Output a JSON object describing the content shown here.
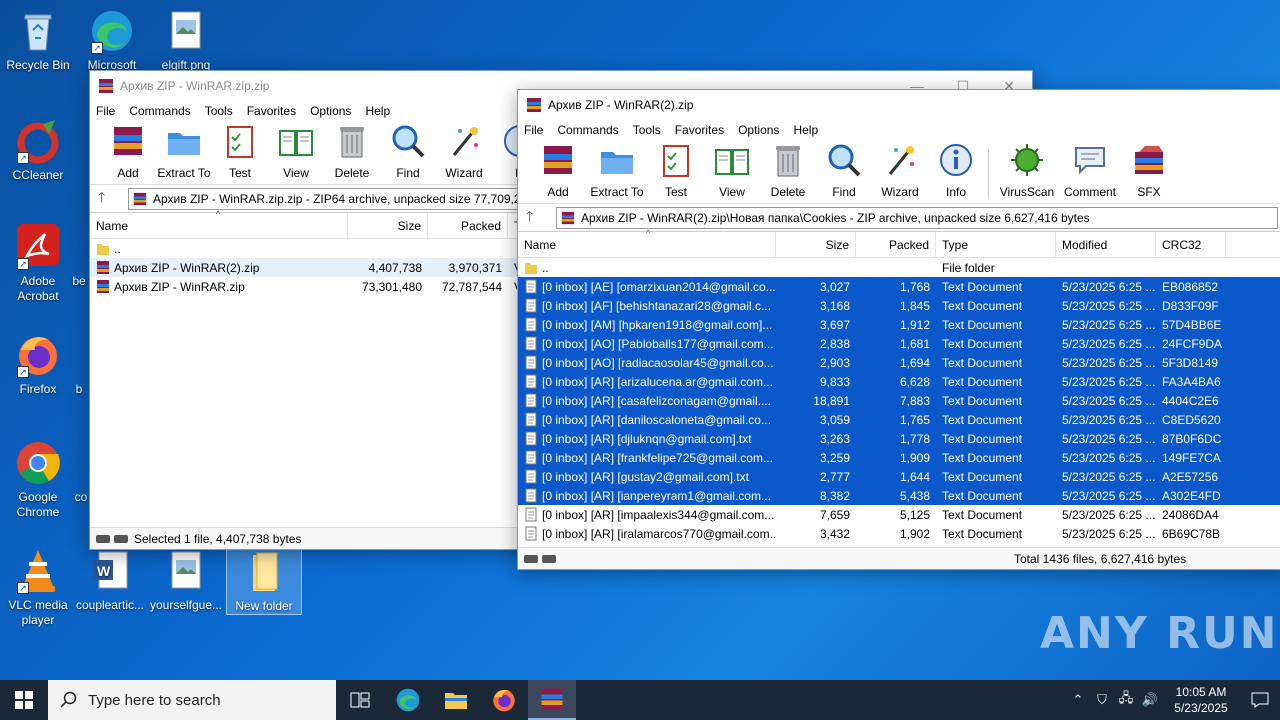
{
  "desktop": {
    "icons": [
      {
        "label": "Recycle Bin"
      },
      {
        "label": "Microsoft"
      },
      {
        "label": "elgift.png"
      },
      {
        "label": "CCleaner"
      },
      {
        "label": "Adobe Acrobat"
      },
      {
        "label": "Firefox"
      },
      {
        "label": "Google Chrome"
      },
      {
        "label": "VLC media player"
      },
      {
        "label": "coupleartic..."
      },
      {
        "label": "yourselfgue..."
      },
      {
        "label": "New folder"
      }
    ],
    "partial_labels": [
      "be",
      "b",
      "co"
    ]
  },
  "win1": {
    "title": "Архив ZIP - WinRAR.zip.zip",
    "menu": [
      "File",
      "Commands",
      "Tools",
      "Favorites",
      "Options",
      "Help"
    ],
    "toolbar": [
      "Add",
      "Extract To",
      "Test",
      "View",
      "Delete",
      "Find",
      "Wizard",
      "In"
    ],
    "address": "Архив ZIP - WinRAR.zip.zip - ZIP64 archive, unpacked size 77,709,2",
    "columns": [
      "Name",
      "Size",
      "Packed",
      "T"
    ],
    "rows": [
      {
        "name": "..",
        "size": "",
        "packed": ""
      },
      {
        "name": "Архив ZIP - WinRAR(2).zip",
        "size": "4,407,738",
        "packed": "3,970,371"
      },
      {
        "name": "Архив ZIP - WinRAR.zip",
        "size": "73,301,480",
        "packed": "72,787,544"
      }
    ],
    "status": "Selected 1 file, 4,407,738 bytes"
  },
  "win2": {
    "title": "Архив ZIP - WinRAR(2).zip",
    "menu": [
      "File",
      "Commands",
      "Tools",
      "Favorites",
      "Options",
      "Help"
    ],
    "toolbar": [
      "Add",
      "Extract To",
      "Test",
      "View",
      "Delete",
      "Find",
      "Wizard",
      "Info",
      "VirusScan",
      "Comment",
      "SFX"
    ],
    "address": "Архив ZIP - WinRAR(2).zip\\Новая папка\\Cookies - ZIP archive, unpacked size 6,627,416 bytes",
    "columns": [
      "Name",
      "Size",
      "Packed",
      "Type",
      "Modified",
      "CRC32"
    ],
    "rows": [
      {
        "name": "..",
        "size": "",
        "packed": "",
        "type": "File folder",
        "modified": "",
        "crc": ""
      },
      {
        "name": "[0 inbox] [AE] [omarzixuan2014@gmail.co...",
        "size": "3,027",
        "packed": "1,768",
        "type": "Text Document",
        "modified": "5/23/2025 6:25 ...",
        "crc": "EB086852"
      },
      {
        "name": "[0 inbox] [AF] [behishtanazari28@gmail.c...",
        "size": "3,168",
        "packed": "1,845",
        "type": "Text Document",
        "modified": "5/23/2025 6:25 ...",
        "crc": "D833F09F"
      },
      {
        "name": "[0 inbox] [AM] [hpkaren1918@gmail.com]...",
        "size": "3,697",
        "packed": "1,912",
        "type": "Text Document",
        "modified": "5/23/2025 6:25 ...",
        "crc": "57D4BB6E"
      },
      {
        "name": "[0 inbox] [AO] [Pabloballs177@gmail.com...",
        "size": "2,838",
        "packed": "1,681",
        "type": "Text Document",
        "modified": "5/23/2025 6:25 ...",
        "crc": "24FCF9DA"
      },
      {
        "name": "[0 inbox] [AO] [radiacaosolar45@gmail.co...",
        "size": "2,903",
        "packed": "1,694",
        "type": "Text Document",
        "modified": "5/23/2025 6:25 ...",
        "crc": "5F3D8149"
      },
      {
        "name": "[0 inbox] [AR] [arizalucena.ar@gmail.com...",
        "size": "9,833",
        "packed": "6,628",
        "type": "Text Document",
        "modified": "5/23/2025 6:25 ...",
        "crc": "FA3A4BA6"
      },
      {
        "name": "[0 inbox] [AR] [casafelizconagam@gmail....",
        "size": "18,891",
        "packed": "7,883",
        "type": "Text Document",
        "modified": "5/23/2025 6:25 ...",
        "crc": "4404C2E6"
      },
      {
        "name": "[0 inbox] [AR] [daniloscaloneta@gmail.co...",
        "size": "3,059",
        "packed": "1,765",
        "type": "Text Document",
        "modified": "5/23/2025 6:25 ...",
        "crc": "C8ED5620"
      },
      {
        "name": "[0 inbox] [AR] [djluknqn@gmail.com].txt",
        "size": "3,263",
        "packed": "1,778",
        "type": "Text Document",
        "modified": "5/23/2025 6:25 ...",
        "crc": "87B0F6DC"
      },
      {
        "name": "[0 inbox] [AR] [frankfelipe725@gmail.com...",
        "size": "3,259",
        "packed": "1,909",
        "type": "Text Document",
        "modified": "5/23/2025 6:25 ...",
        "crc": "149FE7CA"
      },
      {
        "name": "[0 inbox] [AR] [gustay2@gmail.com].txt",
        "size": "2,777",
        "packed": "1,644",
        "type": "Text Document",
        "modified": "5/23/2025 6:25 ...",
        "crc": "A2E57256"
      },
      {
        "name": "[0 inbox] [AR] [ianpereyram1@gmail.com...",
        "size": "8,382",
        "packed": "5,438",
        "type": "Text Document",
        "modified": "5/23/2025 6:25 ...",
        "crc": "A302E4FD"
      },
      {
        "name": "[0 inbox] [AR] [impaalexis344@gmail.com...",
        "size": "7,659",
        "packed": "5,125",
        "type": "Text Document",
        "modified": "5/23/2025 6:25 ...",
        "crc": "24086DA4"
      },
      {
        "name": "[0 inbox] [AR] [iralamarcos770@gmail.com...",
        "size": "3,432",
        "packed": "1,902",
        "type": "Text Document",
        "modified": "5/23/2025 6:25 ...",
        "crc": "6B69C78B"
      }
    ],
    "status": "Total 1436 files, 6,627,416 bytes"
  },
  "taskbar": {
    "search_placeholder": "Type here to search",
    "time": "10:05 AM",
    "date": "5/23/2025"
  },
  "watermark": "ANY RUN"
}
